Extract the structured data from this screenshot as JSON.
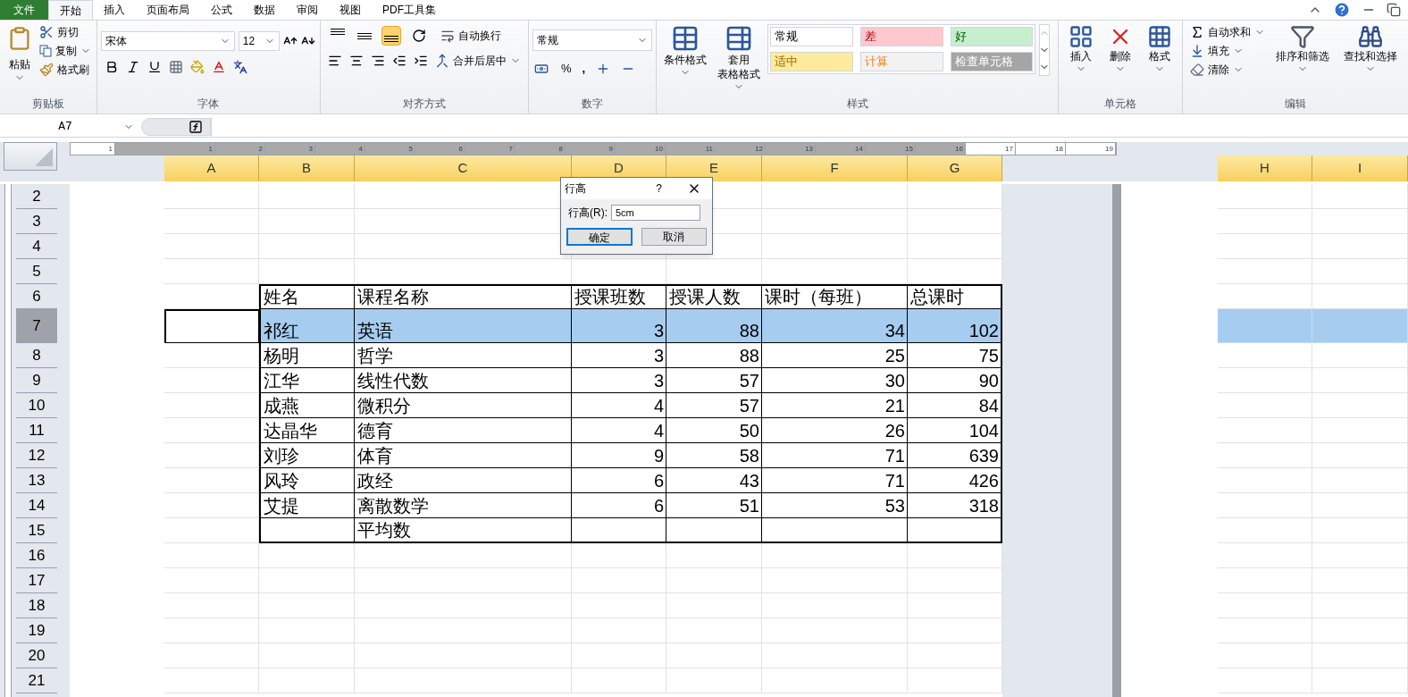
{
  "tabs": [
    {
      "label": "文件",
      "kind": "file",
      "selected": false
    },
    {
      "label": "开始",
      "kind": "tab",
      "selected": true
    },
    {
      "label": "插入",
      "kind": "tab",
      "selected": false
    },
    {
      "label": "页面布局",
      "kind": "tab",
      "selected": false
    },
    {
      "label": "公式",
      "kind": "tab",
      "selected": false
    },
    {
      "label": "数据",
      "kind": "tab",
      "selected": false
    },
    {
      "label": "审阅",
      "kind": "tab",
      "selected": false
    },
    {
      "label": "视图",
      "kind": "tab",
      "selected": false
    },
    {
      "label": "PDF工具集",
      "kind": "tab",
      "selected": false
    }
  ],
  "clipboard": {
    "paste": "粘贴",
    "cut": "剪切",
    "copy": "复制",
    "painter": "格式刷",
    "group": "剪贴板"
  },
  "font": {
    "name": "宋体",
    "size": "12",
    "group": "字体"
  },
  "alignment": {
    "buttons": [
      {
        "kind": "top",
        "selected": false
      },
      {
        "kind": "middle",
        "selected": false
      },
      {
        "kind": "bottom",
        "selected": true
      }
    ],
    "wrap": "自动换行",
    "merge": "合并后居中",
    "group": "对齐方式"
  },
  "number": {
    "format": "常规",
    "percent": "%",
    "comma": ",",
    "group": "数字"
  },
  "styles": {
    "conditional": "条件格式",
    "table_line1": "套用",
    "table_line2": "表格格式",
    "group": "样式",
    "gallery": [
      {
        "label": "常规",
        "color": "#ffffff"
      },
      {
        "label": "差",
        "color": "#ffc7ce"
      },
      {
        "label": "好",
        "color": "#c6efce"
      },
      {
        "label": "适中",
        "color": "#ffeb9c"
      },
      {
        "label": "计算",
        "color": "#f2f2f2"
      },
      {
        "label": "检查单元格",
        "color": "#a5a5a5"
      }
    ]
  },
  "cells": {
    "insert": "插入",
    "delete": "删除",
    "format": "格式",
    "group": "单元格"
  },
  "editing": {
    "autosum": "自动求和",
    "fill": "填充",
    "clear": "清除",
    "sort": "排序和筛选",
    "find": "查找和选择",
    "group": "编辑"
  },
  "name_box": "A7",
  "ruler": [
    "1",
    "1",
    "2",
    "3",
    "4",
    "5",
    "6",
    "7",
    "8",
    "9",
    "10",
    "11",
    "12",
    "13",
    "14",
    "15",
    "16",
    "17",
    "18",
    "19"
  ],
  "columns": [
    "A",
    "B",
    "C",
    "D",
    "E",
    "F",
    "G"
  ],
  "right_columns": [
    "H",
    "I"
  ],
  "rows": [
    {
      "header": "2",
      "kind": "blank",
      "selected": false,
      "cells": [
        "",
        "",
        "",
        "",
        "",
        "",
        ""
      ]
    },
    {
      "header": "3",
      "kind": "blank",
      "selected": false,
      "cells": [
        "",
        "",
        "",
        "",
        "",
        "",
        ""
      ]
    },
    {
      "header": "4",
      "kind": "blank",
      "selected": false,
      "cells": [
        "",
        "",
        "",
        "",
        "",
        "",
        ""
      ]
    },
    {
      "header": "5",
      "kind": "blank",
      "selected": false,
      "cells": [
        "",
        "",
        "",
        "",
        "",
        "",
        ""
      ]
    },
    {
      "header": "6",
      "kind": "header",
      "selected": false,
      "cells": [
        "",
        "姓名",
        "课程名称",
        "授课班数",
        "授课人数",
        "课时（每班）",
        "总课时"
      ]
    },
    {
      "header": "7",
      "kind": "data",
      "selected": true,
      "cells": [
        "",
        "祁红",
        "英语",
        "3",
        "88",
        "34",
        "102"
      ]
    },
    {
      "header": "8",
      "kind": "data",
      "selected": false,
      "cells": [
        "",
        "杨明",
        "哲学",
        "3",
        "88",
        "25",
        "75"
      ]
    },
    {
      "header": "9",
      "kind": "data",
      "selected": false,
      "cells": [
        "",
        "江华",
        "线性代数",
        "3",
        "57",
        "30",
        "90"
      ]
    },
    {
      "header": "10",
      "kind": "data",
      "selected": false,
      "cells": [
        "",
        "成燕",
        "微积分",
        "4",
        "57",
        "21",
        "84"
      ]
    },
    {
      "header": "11",
      "kind": "data",
      "selected": false,
      "cells": [
        "",
        "达晶华",
        "德育",
        "4",
        "50",
        "26",
        "104"
      ]
    },
    {
      "header": "12",
      "kind": "data",
      "selected": false,
      "cells": [
        "",
        "刘珍",
        "体育",
        "9",
        "58",
        "71",
        "639"
      ]
    },
    {
      "header": "13",
      "kind": "data",
      "selected": false,
      "cells": [
        "",
        "风玲",
        "政经",
        "6",
        "43",
        "71",
        "426"
      ]
    },
    {
      "header": "14",
      "kind": "data",
      "selected": false,
      "cells": [
        "",
        "艾提",
        "离散数学",
        "6",
        "51",
        "53",
        "318"
      ]
    },
    {
      "header": "15",
      "kind": "footer",
      "selected": false,
      "cells": [
        "",
        "",
        "平均数",
        "",
        "",
        "",
        ""
      ]
    },
    {
      "header": "16",
      "kind": "blank",
      "selected": false,
      "cells": [
        "",
        "",
        "",
        "",
        "",
        "",
        ""
      ]
    },
    {
      "header": "17",
      "kind": "blank",
      "selected": false,
      "cells": [
        "",
        "",
        "",
        "",
        "",
        "",
        ""
      ]
    },
    {
      "header": "18",
      "kind": "blank",
      "selected": false,
      "cells": [
        "",
        "",
        "",
        "",
        "",
        "",
        ""
      ]
    },
    {
      "header": "19",
      "kind": "blank",
      "selected": false,
      "cells": [
        "",
        "",
        "",
        "",
        "",
        "",
        ""
      ]
    },
    {
      "header": "20",
      "kind": "blank",
      "selected": false,
      "cells": [
        "",
        "",
        "",
        "",
        "",
        "",
        ""
      ]
    },
    {
      "header": "21",
      "kind": "blank",
      "selected": false,
      "cells": [
        "",
        "",
        "",
        "",
        "",
        "",
        ""
      ]
    }
  ],
  "dialog": {
    "title": "行高",
    "help": "?",
    "label": "行高(R):",
    "value": "5cm",
    "ok": "确定",
    "cancel": "取消"
  }
}
